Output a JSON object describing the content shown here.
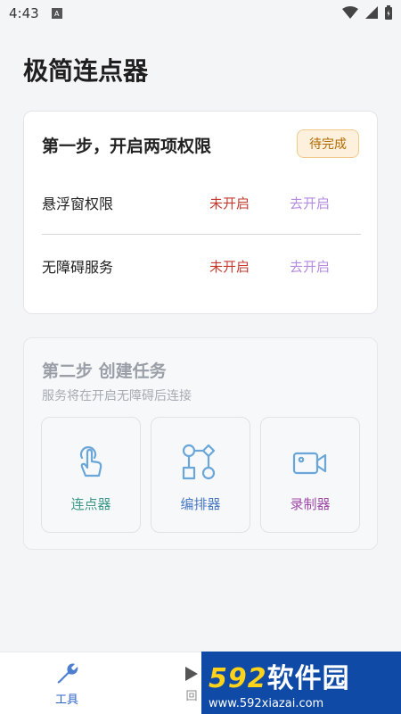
{
  "status_bar": {
    "time": "4:43",
    "notif_icon": "A"
  },
  "app": {
    "title": "极简连点器"
  },
  "step1": {
    "title": "第一步，开启两项权限",
    "badge": "待完成",
    "permissions": [
      {
        "label": "悬浮窗权限",
        "status": "未开启",
        "action": "去开启"
      },
      {
        "label": "无障碍服务",
        "status": "未开启",
        "action": "去开启"
      }
    ]
  },
  "step2": {
    "title": "第二步 创建任务",
    "subtitle": "服务将在开启无障碍后连接",
    "tools": [
      {
        "label": "连点器",
        "icon": "tap-finger-icon",
        "color": "#3d9a8a"
      },
      {
        "label": "编排器",
        "icon": "flowchart-icon",
        "color": "#4a7ac2"
      },
      {
        "label": "录制器",
        "icon": "video-camera-icon",
        "color": "#a04aa8"
      }
    ]
  },
  "bottom_nav": {
    "tools_label": "工具",
    "record_label": "回"
  },
  "watermark": {
    "number": "592",
    "text": "软件园",
    "url": "www.592xiazai.com"
  },
  "colors": {
    "accent": "#2f66c4",
    "status_off": "#c43a2f",
    "action": "#b58be0",
    "badge_bg": "#fdf1dd"
  }
}
